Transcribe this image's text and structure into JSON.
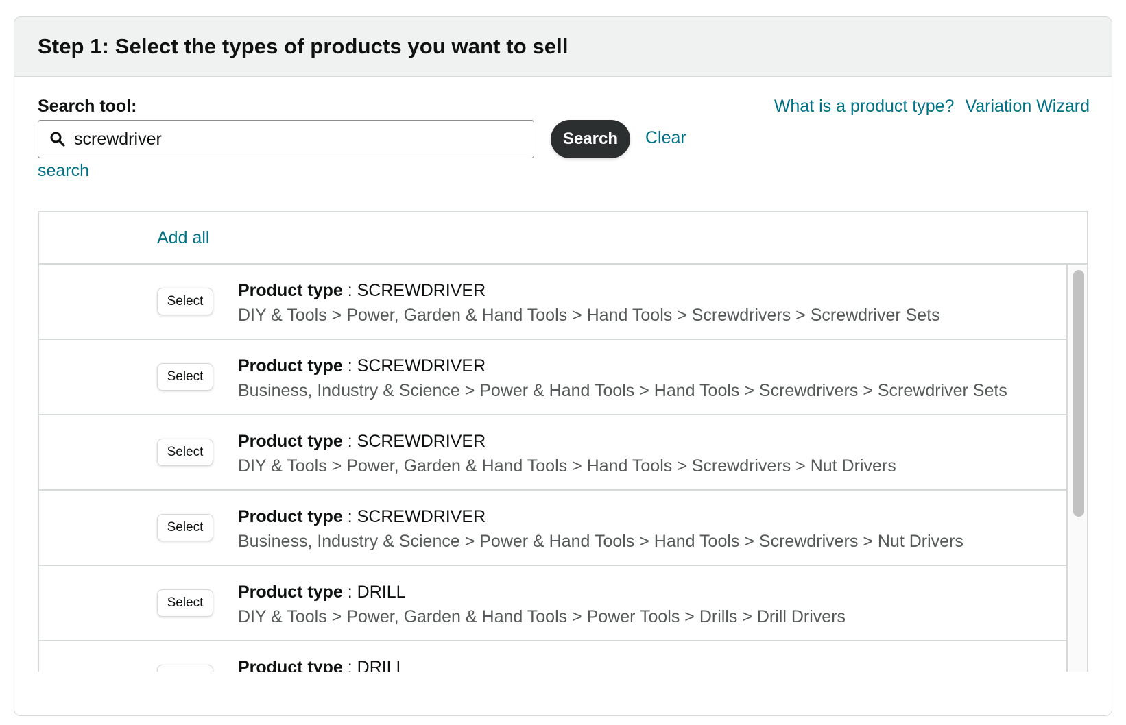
{
  "header": {
    "title": "Step 1: Select the types of products you want to sell"
  },
  "search": {
    "label": "Search tool:",
    "value": "screwdriver",
    "button_label": "Search",
    "clear_label": "Clear",
    "sub_link": "search"
  },
  "top_links": {
    "product_type_help": "What is a product type?",
    "variation_wizard": "Variation Wizard"
  },
  "results": {
    "add_all_label": "Add all",
    "select_label": "Select",
    "product_type_label": "Product type",
    "separator": " : ",
    "rows": [
      {
        "type": "SCREWDRIVER",
        "path": "DIY & Tools > Power, Garden & Hand Tools > Hand Tools > Screwdrivers > Screwdriver Sets"
      },
      {
        "type": "SCREWDRIVER",
        "path": "Business, Industry & Science > Power & Hand Tools > Hand Tools > Screwdrivers > Screwdriver Sets"
      },
      {
        "type": "SCREWDRIVER",
        "path": "DIY & Tools > Power, Garden & Hand Tools > Hand Tools > Screwdrivers > Nut Drivers"
      },
      {
        "type": "SCREWDRIVER",
        "path": "Business, Industry & Science > Power & Hand Tools > Hand Tools > Screwdrivers > Nut Drivers"
      },
      {
        "type": "DRILL",
        "path": "DIY & Tools > Power, Garden & Hand Tools > Power Tools > Drills > Drill Drivers"
      },
      {
        "type": "DRILL",
        "path": ""
      }
    ]
  },
  "colors": {
    "link": "#007185",
    "button_dark": "#2b2f30",
    "header_bg": "#f0f2f2",
    "border": "#d5d9d9"
  }
}
